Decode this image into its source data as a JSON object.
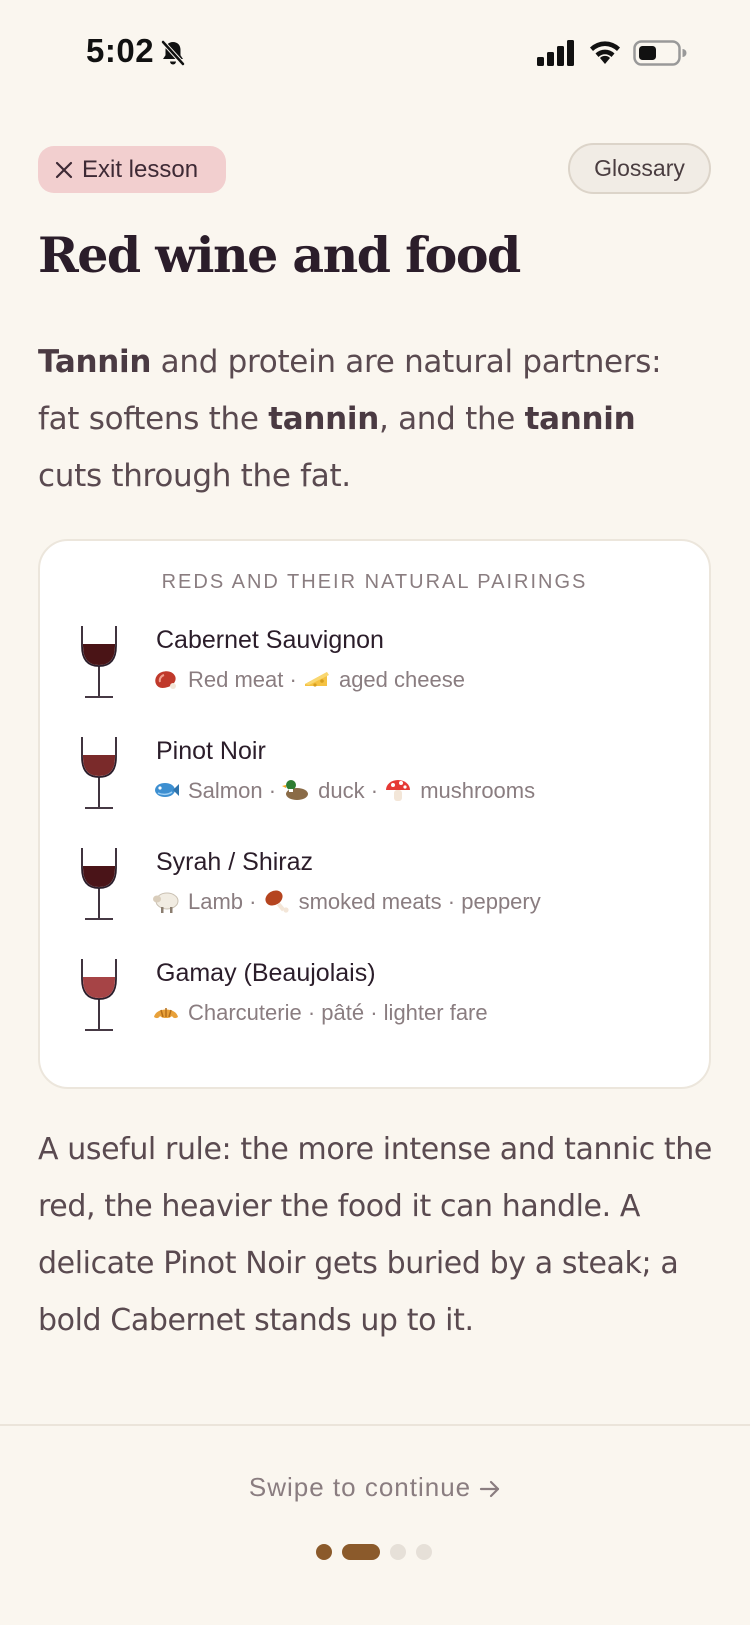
{
  "status_bar": {
    "time": "5:02",
    "icons": [
      "bell-slash-icon",
      "cellular-signal-icon",
      "wifi-icon",
      "battery-icon"
    ]
  },
  "header": {
    "exit_label": "Exit lesson",
    "glossary_label": "Glossary"
  },
  "lesson": {
    "title": "Red wine and food",
    "intro": {
      "w1": "Tannin",
      "t1": " and protein are natural partners: fat softens the ",
      "w2": "tannin",
      "t2": ", and the ",
      "w3": "tannin",
      "t3": " cuts through the fat."
    },
    "card": {
      "heading": "REDS AND THEIR NATURAL PAIRINGS",
      "wines": [
        {
          "name": "Cabernet Sauvignon",
          "glass_color": "#4a1416",
          "pairings": [
            {
              "icon": "meat-icon",
              "text": "Red meat"
            },
            {
              "icon": "cheese-icon",
              "text": "aged cheese"
            }
          ]
        },
        {
          "name": "Pinot Noir",
          "glass_color": "#7a2a2a",
          "pairings": [
            {
              "icon": "fish-icon",
              "text": "Salmon"
            },
            {
              "icon": "duck-icon",
              "text": "duck"
            },
            {
              "icon": "mushroom-icon",
              "text": "mushrooms"
            }
          ]
        },
        {
          "name": "Syrah / Shiraz",
          "glass_color": "#4a1418",
          "pairings": [
            {
              "icon": "sheep-icon",
              "text": "Lamb"
            },
            {
              "icon": "drumstick-icon",
              "text": "smoked meats"
            },
            {
              "icon": "",
              "text": "peppery"
            }
          ]
        },
        {
          "name": "Gamay (Beaujolais)",
          "glass_color": "#a64446",
          "pairings": [
            {
              "icon": "croissant-icon",
              "text": "Charcuterie"
            },
            {
              "icon": "",
              "text": "pâté"
            },
            {
              "icon": "",
              "text": "lighter fare"
            }
          ]
        }
      ]
    },
    "rule": "A useful rule: the more intense and tannic the red, the heavier the food it can handle. A delicate Pinot Noir gets buried by a steak; a bold Cabernet stands up to it."
  },
  "footer": {
    "swipe_label": "Swipe to continue",
    "page_count": 4,
    "current_page": 2,
    "accent_color": "#8b5a2b"
  }
}
